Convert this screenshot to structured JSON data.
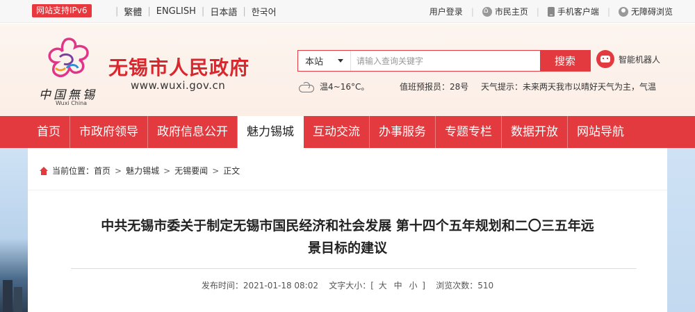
{
  "topbar": {
    "ipv6_badge": "网站支持IPv6",
    "languages": [
      "繁體",
      "ENGLISH",
      "日本語",
      "한국어"
    ],
    "links": [
      {
        "label": "用户登录",
        "icon": "none"
      },
      {
        "label": "市民主页",
        "icon": "home-icon"
      },
      {
        "label": "手机客户端",
        "icon": "phone-icon"
      },
      {
        "label": "无障碍浏览",
        "icon": "person-icon"
      }
    ]
  },
  "header": {
    "logo_cn": "中国無锡",
    "logo_en": "Wuxi China",
    "site_title": "无锡市人民政府",
    "site_url": "www.wuxi.gov.cn",
    "search": {
      "scope": "本站",
      "placeholder": "请输入查询关键字",
      "button": "搜索"
    },
    "robot_label": "智能机器人",
    "weather": "温4~16°C。",
    "duty": "值班预报员：28号",
    "tip": "天气提示：未来两天我市以晴好天气为主，气温"
  },
  "nav": {
    "items": [
      "首页",
      "市政府领导",
      "政府信息公开",
      "魅力锡城",
      "互动交流",
      "办事服务",
      "专题专栏",
      "数据开放",
      "网站导航"
    ],
    "active": "魅力锡城"
  },
  "breadcrumb": {
    "prefix": "当前位置：",
    "items": [
      "首页",
      "魅力锡城",
      "无锡要闻",
      "正文"
    ]
  },
  "article": {
    "title_line1": "中共无锡市委关于制定无锡市国民经济和社会发展 第十四个五年规划和二〇三五年远",
    "title_line2": "景目标的建议",
    "publish_label": "发布时间：",
    "publish_time": "2021-01-18 08:02",
    "fontsize_label": "文字大小：[",
    "fontsize_options": [
      "大",
      "中",
      "小"
    ],
    "fontsize_end": "]",
    "views_label": "浏览次数：",
    "views": "510"
  },
  "colors": {
    "brand_red": "#e23a3f",
    "title_red": "#d9272e"
  }
}
